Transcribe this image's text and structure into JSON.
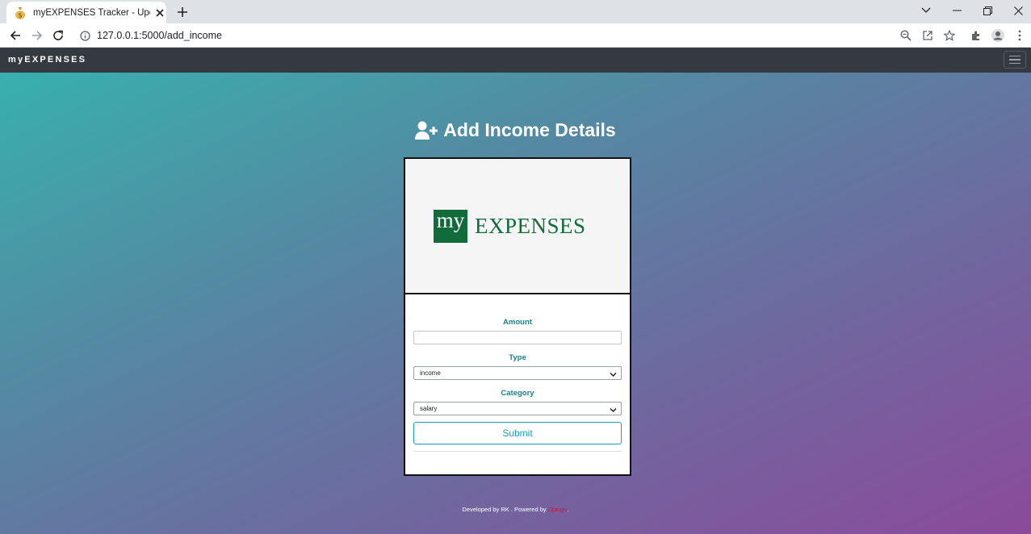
{
  "browser": {
    "tab_title": "myEXPENSES Tracker - Update Income",
    "url": "127.0.0.1:5000/add_income"
  },
  "navbar": {
    "brand": "myEXPENSES"
  },
  "page": {
    "heading": "Add Income Details",
    "logo_box_text": "my",
    "logo_word": "EXPENSES"
  },
  "form": {
    "amount_label": "Amount",
    "amount_value": "",
    "type_label": "Type",
    "type_selected": "income",
    "category_label": "Category",
    "category_selected": "salary",
    "submit_label": "Submit"
  },
  "footer": {
    "text": "Developed by RK . Powered by ",
    "powered_by": "Django",
    "end": "."
  },
  "colors": {
    "nav_bg": "#343a40",
    "label_color": "#17848f",
    "button_color": "#17a2b8",
    "logo_green": "#116b3a",
    "footer_link": "#e8102a"
  }
}
